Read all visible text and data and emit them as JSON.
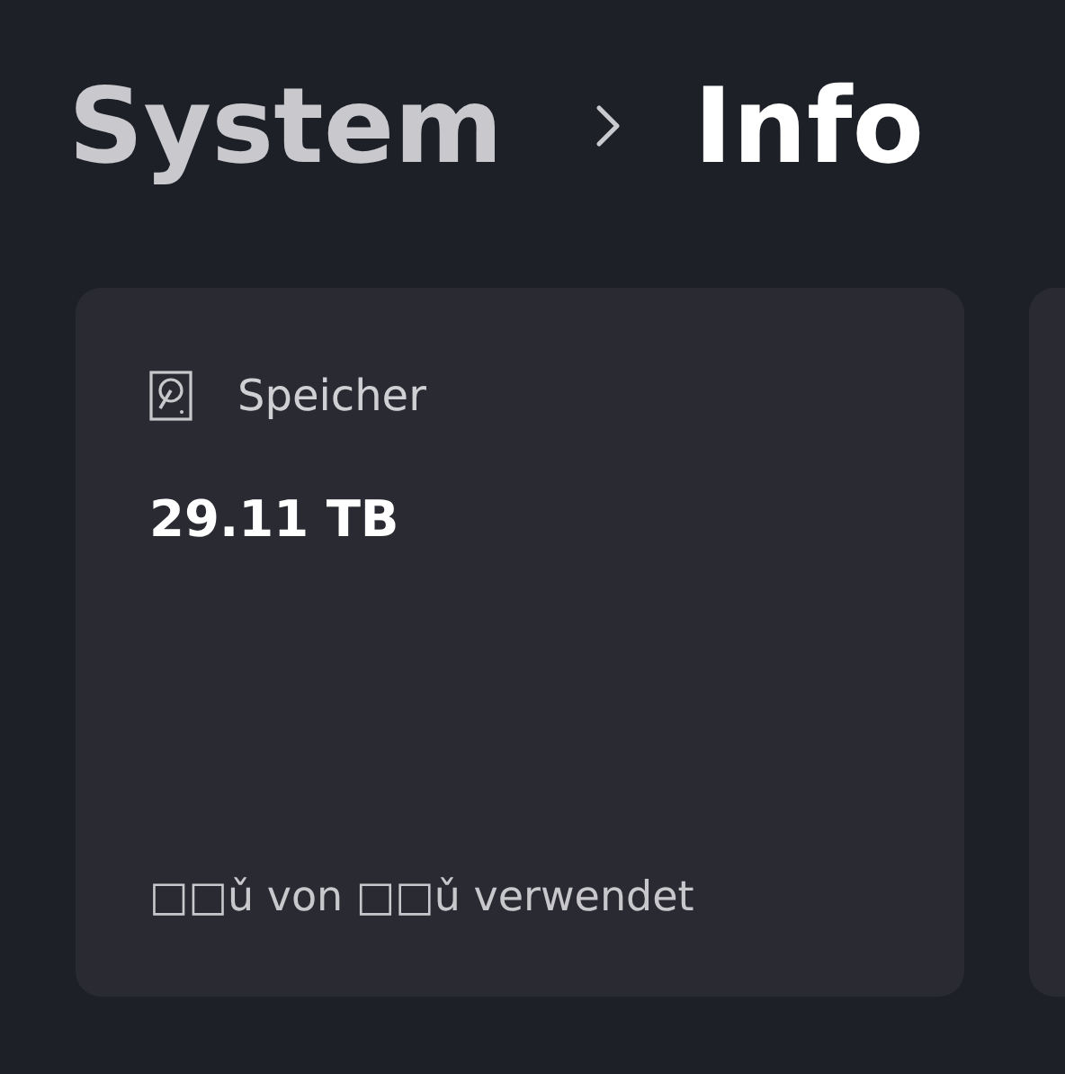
{
  "breadcrumb": [
    {
      "label": "System",
      "current": false
    },
    {
      "label": "Info",
      "current": true
    }
  ],
  "cards": [
    {
      "title": "Speicher",
      "value": "29.11 TB",
      "footer": "□□ǔ von □□ǔ verwendet"
    }
  ]
}
